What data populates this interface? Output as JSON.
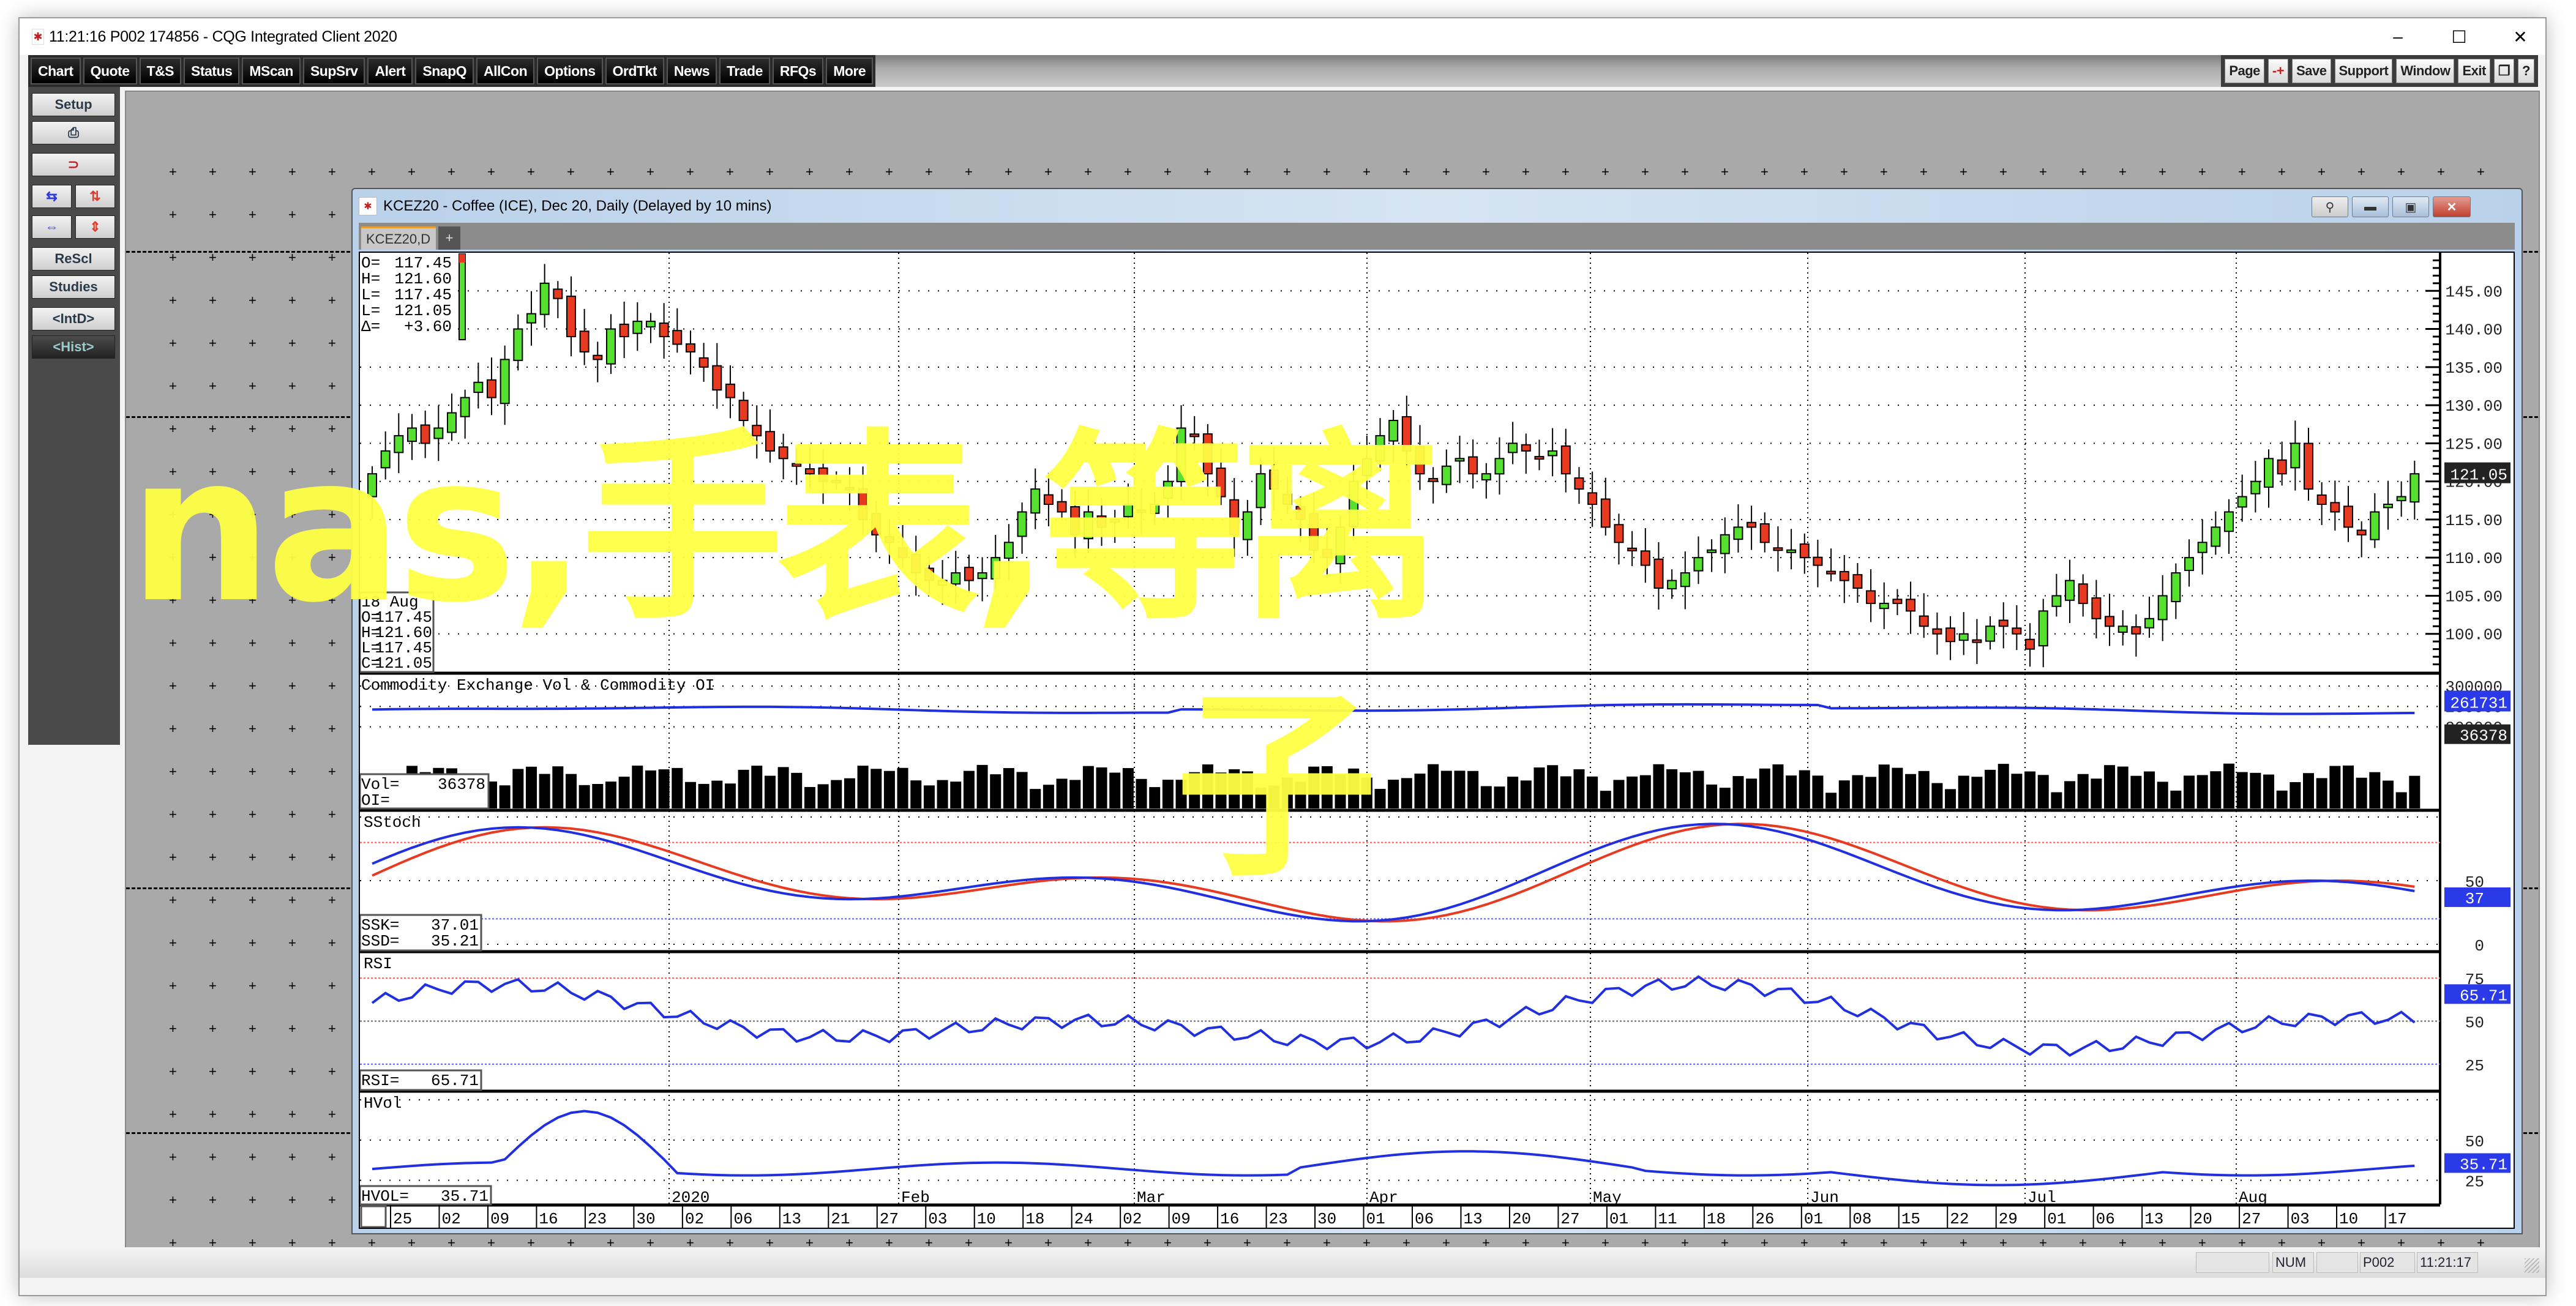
{
  "window": {
    "title": "11:21:16   P002   174856 - CQG Integrated Client 2020",
    "minimize": "–",
    "maximize": "☐",
    "close": "✕"
  },
  "toolbar": {
    "left": [
      "Chart",
      "Quote",
      "T&S",
      "Status",
      "MScan",
      "SupSrv",
      "Alert",
      "SnapQ",
      "AllCon",
      "Options",
      "OrdTkt",
      "News",
      "Trade",
      "RFQs",
      "More"
    ],
    "right": [
      "Page",
      "-+",
      "Save",
      "Support",
      "Window",
      "Exit",
      "❐",
      "?"
    ]
  },
  "sidebar": {
    "setup": "Setup",
    "print_icon": "⎙",
    "magnet_icon": "⊃",
    "rescale": "ReScl",
    "studies": "Studies",
    "intd": "<IntD>",
    "hist": "<Hist>",
    "arrows": [
      "⇆",
      "⇅",
      "⇔",
      "⇕"
    ]
  },
  "chart_window": {
    "title": "KCEZ20 - Coffee (ICE), Dec 20, Daily (Delayed by 10 mins)",
    "tab_label": "KCEZ20,D",
    "tab_add": "+"
  },
  "status_bar": {
    "num": "NUM",
    "page": "P002",
    "time": "11:21:17"
  },
  "overlay_text": {
    "line1": "nas,手表,等离",
    "line2": "子"
  },
  "chart_data": [
    {
      "type": "candlestick",
      "title": "KCEZ20 Daily",
      "info_box": {
        "O": "117.45",
        "H": "121.60",
        "L": "117.45",
        "C": "121.05",
        "delta": "+3.60"
      },
      "info_box_2": {
        "date": "18 Aug",
        "O": "117.45",
        "H": "121.60",
        "L": "117.45",
        "C": "121.05"
      },
      "last_price_label": "121.05",
      "ylim": [
        95,
        150
      ],
      "yticks": [
        "145.00",
        "140.00",
        "135.00",
        "130.00",
        "125.00",
        "120.00",
        "115.00",
        "110.00",
        "105.00",
        "100.00"
      ],
      "colors": {
        "up": "#55e030",
        "down": "#e83a20"
      },
      "closes": [
        121,
        124,
        126,
        127,
        125,
        127,
        129,
        131,
        133,
        131,
        136,
        140,
        142,
        146,
        144,
        139,
        137,
        136,
        140,
        139,
        141,
        141,
        139,
        138,
        137,
        135,
        132,
        131,
        128,
        126,
        124,
        123,
        122,
        121,
        120,
        120,
        119,
        115,
        113,
        112,
        110,
        108,
        107,
        107,
        108,
        107,
        108,
        110,
        112,
        116,
        119,
        117,
        116,
        113,
        116,
        114,
        115,
        117,
        116,
        117,
        120,
        127,
        126,
        121,
        118,
        113,
        116,
        121,
        119,
        117,
        115,
        111,
        110,
        114,
        120,
        123,
        126,
        128,
        124,
        121,
        120,
        122,
        123,
        121,
        121,
        123,
        125,
        124,
        123,
        124,
        121,
        119,
        117,
        114,
        112,
        111,
        109,
        106,
        107,
        108,
        110,
        111,
        113,
        114,
        114,
        112,
        111,
        111,
        110,
        109,
        108,
        107,
        106,
        104,
        104,
        104,
        103,
        101,
        100,
        99,
        100,
        99,
        101,
        101,
        100,
        98,
        103,
        105,
        107,
        104,
        102,
        101,
        101,
        100,
        102,
        105,
        108,
        110,
        112,
        114,
        116,
        118,
        120,
        123,
        121,
        125,
        119,
        117,
        116,
        114,
        113,
        116,
        117,
        118,
        121
      ]
    },
    {
      "type": "bar",
      "title": "Commodity Exchange Vol & Commodity OI",
      "info_box": {
        "Vol": "36378",
        "OI": ""
      },
      "last_vol_label": "36378",
      "last_oi_label": "261731",
      "yticks": [
        "300000",
        "250000",
        "200000"
      ],
      "ylim": [
        0,
        330000
      ],
      "oi_color": "#2030e0"
    },
    {
      "type": "line",
      "title": "SStoch",
      "info_box": {
        "SSK": "37.01",
        "SSD": "35.21"
      },
      "last_label": "37",
      "yticks": [
        "50",
        "0"
      ],
      "ylim": [
        0,
        100
      ],
      "ref_lines": [
        80,
        20
      ],
      "series": [
        {
          "name": "SSK",
          "color": "#2030e0"
        },
        {
          "name": "SSD",
          "color": "#e83a20"
        }
      ]
    },
    {
      "type": "line",
      "title": "RSI",
      "info_box": {
        "RSI": "65.71"
      },
      "last_label": "65.71",
      "yticks": [
        "75",
        "50",
        "25"
      ],
      "ylim": [
        10,
        90
      ],
      "ref_lines": [
        75,
        50,
        25
      ]
    },
    {
      "type": "line",
      "title": "HVol",
      "info_box": {
        "HVOL": "35.71"
      },
      "last_label": "35.71",
      "yticks": [
        "50",
        "25"
      ],
      "ylim": [
        10,
        80
      ]
    }
  ],
  "x_axis": {
    "months": [
      "2020",
      "Feb",
      "Mar",
      "Apr",
      "May",
      "Jun",
      "Jul",
      "Aug"
    ],
    "days": [
      "25",
      "02",
      "09",
      "16",
      "23",
      "30",
      "02",
      "06",
      "13",
      "21",
      "27",
      "03",
      "10",
      "18",
      "24",
      "02",
      "09",
      "16",
      "23",
      "30",
      "01",
      "06",
      "13",
      "20",
      "27",
      "01",
      "11",
      "18",
      "26",
      "01",
      "08",
      "15",
      "22",
      "29",
      "01",
      "06",
      "13",
      "20",
      "27",
      "03",
      "10",
      "17"
    ]
  }
}
